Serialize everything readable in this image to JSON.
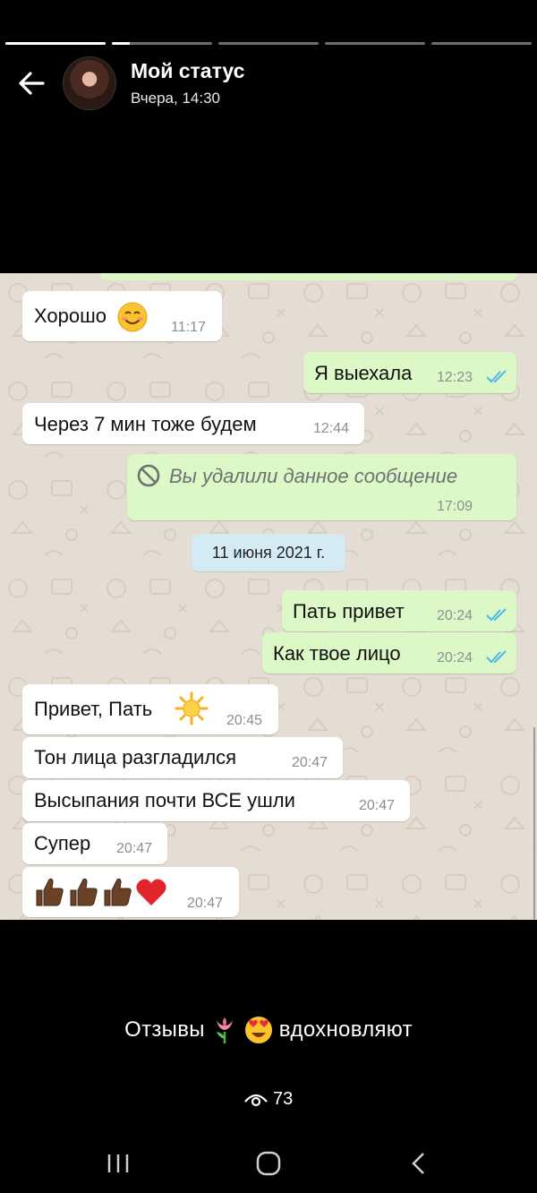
{
  "status": {
    "title": "Мой статус",
    "time": "Вчера, 14:30",
    "progress_segments": [
      1,
      0.18,
      0,
      0,
      0
    ],
    "caption_before": "Отзывы",
    "caption_after": "вдохновляют",
    "views": "73"
  },
  "chat": {
    "messages": [
      {
        "dir": "in",
        "text": "Хорошо",
        "emoji": "smile-emoji",
        "time": "11:17"
      },
      {
        "dir": "out",
        "text": "Я выехала",
        "time": "12:23",
        "read": true
      },
      {
        "dir": "in",
        "text": "Через 7 мин тоже будем",
        "time": "12:44"
      },
      {
        "dir": "out",
        "text": "Вы удалили данное сообщение",
        "time": "17:09",
        "deleted": true
      },
      {
        "dir": "date",
        "text": "11 июня 2021 г."
      },
      {
        "dir": "out",
        "text": "Пать привет",
        "time": "20:24",
        "read": true
      },
      {
        "dir": "out",
        "text": "Как твое лицо",
        "time": "20:24",
        "read": true
      },
      {
        "dir": "in",
        "text": "Привет, Пать",
        "emoji": "sun-emoji",
        "time": "20:45"
      },
      {
        "dir": "in",
        "text": "Тон лица разгладился",
        "time": "20:47"
      },
      {
        "dir": "in",
        "text": "Высыпания почти ВСЕ ушли",
        "time": "20:47"
      },
      {
        "dir": "in",
        "text": "Супер",
        "time": "20:47"
      },
      {
        "dir": "in",
        "text": "",
        "emoji": "thumbs-heart-emoji",
        "time": "20:47"
      }
    ]
  },
  "colors": {
    "incoming": "#ffffff",
    "outgoing": "#dcf8c6",
    "read_ticks": "#4fb6ec",
    "date_chip": "#d4eaf4"
  }
}
